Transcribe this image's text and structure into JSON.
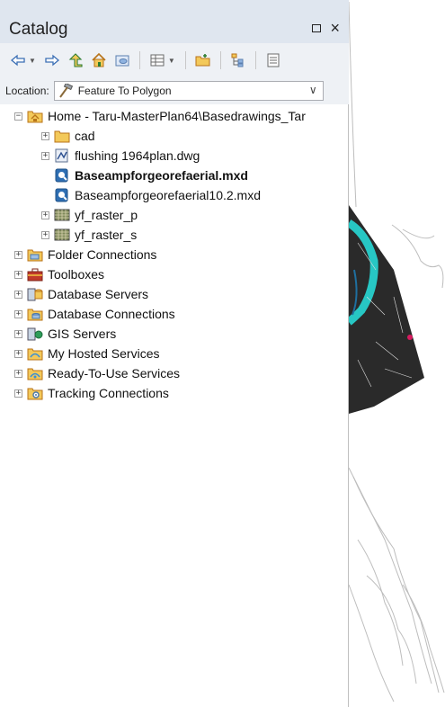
{
  "panel": {
    "title": "Catalog",
    "float_icon": "float-icon",
    "close_icon": "close-icon"
  },
  "toolbar": {
    "buttons": [
      "back-icon",
      "forward-icon",
      "up-folder-icon",
      "home-icon",
      "default-gdb-icon",
      "view-menu-icon",
      "connect-folder-icon",
      "toggle-tree-icon",
      "options-icon"
    ]
  },
  "location": {
    "label": "Location:",
    "value": "Feature To Polygon",
    "icon": "hammer-icon"
  },
  "tree": {
    "home": {
      "label": "Home - Taru-MasterPlan64\\Basedrawings_Tar"
    },
    "children": [
      {
        "label": "cad",
        "icon": "folder-icon"
      },
      {
        "label": "flushing 1964plan.dwg",
        "icon": "cad-drawing-icon"
      },
      {
        "label": "Baseampforgeorefaerial.mxd",
        "icon": "map-document-icon",
        "bold": true
      },
      {
        "label": "Baseampforgeorefaerial10.2.mxd",
        "icon": "map-document-icon"
      },
      {
        "label": "yf_raster_p",
        "icon": "raster-icon"
      },
      {
        "label": "yf_raster_s",
        "icon": "raster-icon"
      }
    ],
    "top_level": [
      {
        "label": "Folder Connections",
        "icon": "folder-connections-icon"
      },
      {
        "label": "Toolboxes",
        "icon": "toolbox-icon"
      },
      {
        "label": "Database Servers",
        "icon": "database-server-icon"
      },
      {
        "label": "Database Connections",
        "icon": "database-connection-icon"
      },
      {
        "label": "GIS Servers",
        "icon": "gis-server-icon"
      },
      {
        "label": "My Hosted Services",
        "icon": "hosted-services-icon"
      },
      {
        "label": "Ready-To-Use Services",
        "icon": "ready-services-icon"
      },
      {
        "label": "Tracking Connections",
        "icon": "tracking-connections-icon"
      }
    ]
  },
  "colors": {
    "titlebar": "#dfe6ef",
    "toolbar": "#eef1f5",
    "folder": "#f3c95a",
    "water": "#27c7c4"
  }
}
